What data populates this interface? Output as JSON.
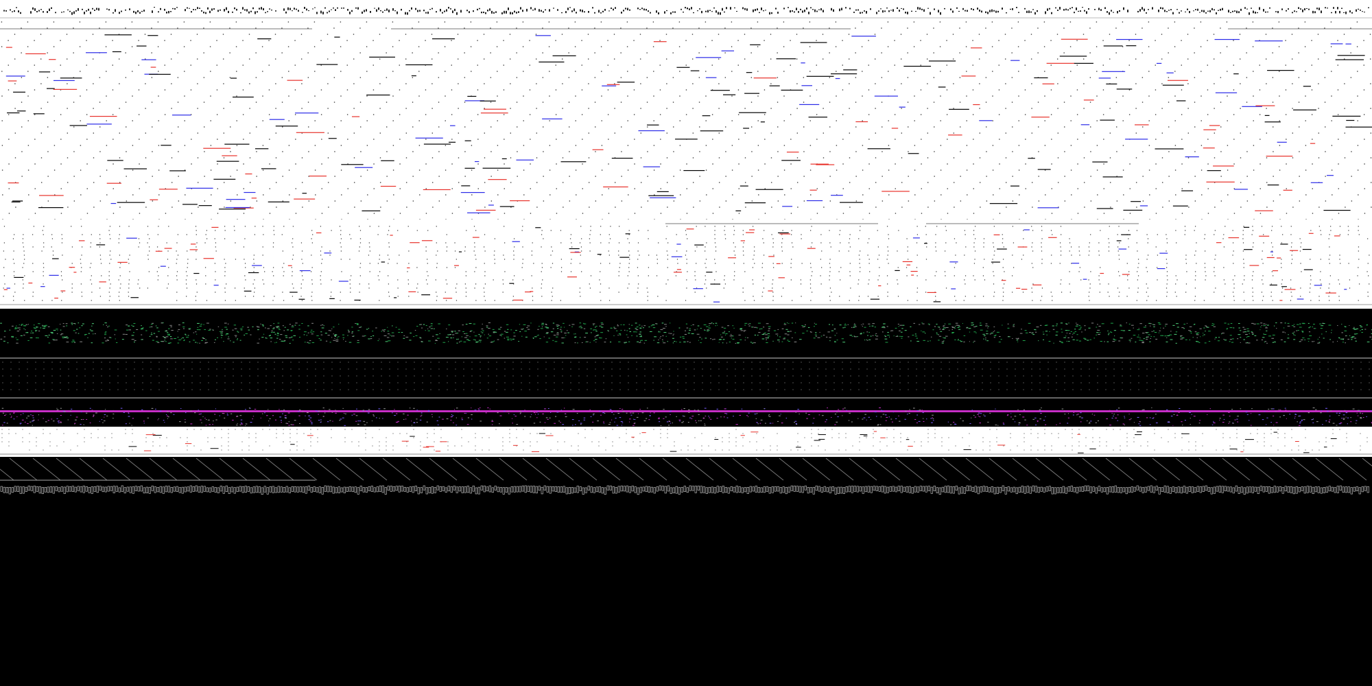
{
  "page": {
    "header_text": "",
    "body_text": "",
    "footer_text": ""
  },
  "colors": {
    "background_light": "#ffffff",
    "background_dark": "#000000",
    "mark_black": "#000000",
    "mark_red": "#e8312a",
    "mark_blue": "#2a2ae8",
    "strip_green": "#1fa34a",
    "strip_magenta": "#c62ec6",
    "glyph_light": "#d8d8d8"
  }
}
